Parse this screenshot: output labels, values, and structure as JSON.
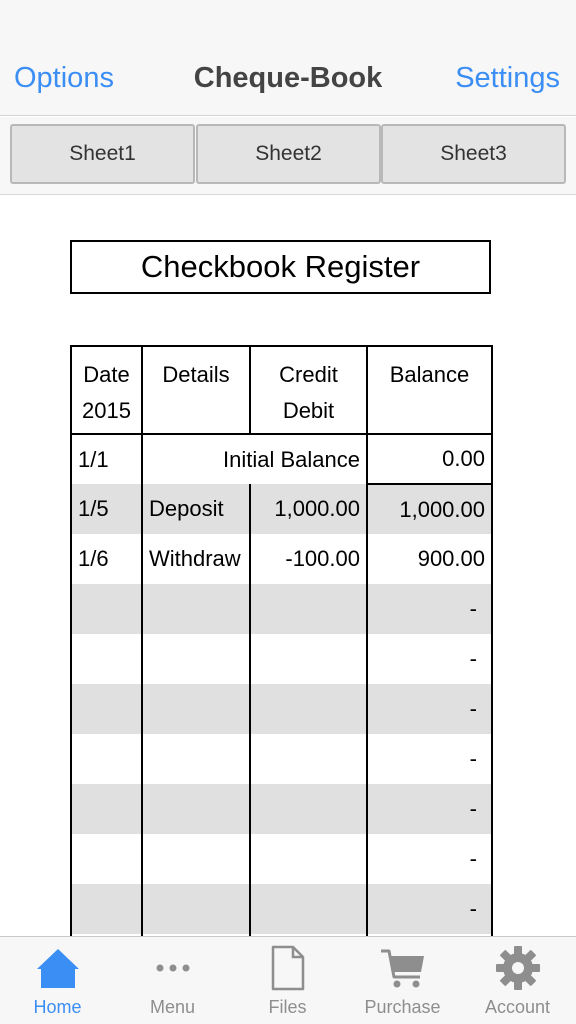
{
  "nav": {
    "left": "Options",
    "title": "Cheque-Book",
    "right": "Settings"
  },
  "sheets": [
    "Sheet1",
    "Sheet2",
    "Sheet3"
  ],
  "register": {
    "title": "Checkbook Register",
    "headers": {
      "date": [
        "Date",
        "2015"
      ],
      "details": "Details",
      "amount": [
        "Credit",
        "Debit"
      ],
      "balance": "Balance"
    },
    "initial": {
      "date": "1/1",
      "label": "Initial Balance",
      "balance": "0.00"
    },
    "rows": [
      {
        "date": "1/5",
        "details": "Deposit",
        "amount": "1,000.00",
        "balance": "1,000.00"
      },
      {
        "date": "1/6",
        "details": "Withdraw",
        "amount": "-100.00",
        "balance": "900.00"
      }
    ],
    "empty_balance": "-"
  },
  "tabbar": [
    {
      "label": "Home",
      "icon": "home-icon",
      "active": true
    },
    {
      "label": "Menu",
      "icon": "more-dots-icon",
      "active": false
    },
    {
      "label": "Files",
      "icon": "file-icon",
      "active": false
    },
    {
      "label": "Purchase",
      "icon": "cart-icon",
      "active": false
    },
    {
      "label": "Account",
      "icon": "gear-icon",
      "active": false
    }
  ],
  "colors": {
    "accent": "#3b8ef3",
    "inactive": "#8e8e8e",
    "row_shade": "#e0e0e0"
  }
}
